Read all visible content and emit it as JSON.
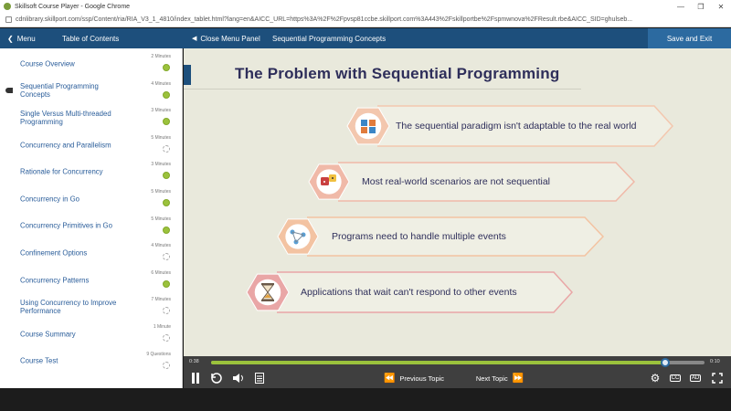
{
  "window": {
    "title": "Skillsoft Course Player - Google Chrome",
    "url": "cdnlibrary.skillport.com/ssp/Content/ria/RIA_V3_1_4810/index_tablet.html?lang=en&AICC_URL=https%3A%2F%2Fpvsp81ccbe.skillport.com%3A443%2Fskillportbe%2Fspmwnova%2FResult.rbe&AICC_SID=ghulseb..."
  },
  "topbar": {
    "menu_label": "Menu",
    "toc_title": "Table of Contents",
    "close_panel_label": "Close Menu Panel",
    "module_title": "Sequential Programming Concepts",
    "save_exit_label": "Save and Exit"
  },
  "toc": [
    {
      "label": "Course Overview",
      "duration": "2 Minutes",
      "status": "done",
      "current": false
    },
    {
      "label": "Sequential Programming Concepts",
      "duration": "4 Minutes",
      "status": "done",
      "current": true
    },
    {
      "label": "Single Versus Multi-threaded Programming",
      "duration": "3 Minutes",
      "status": "done",
      "current": false
    },
    {
      "label": "Concurrency and Parallelism",
      "duration": "5 Minutes",
      "status": "todo",
      "current": false
    },
    {
      "label": "Rationale for Concurrency",
      "duration": "3 Minutes",
      "status": "done",
      "current": false
    },
    {
      "label": "Concurrency in Go",
      "duration": "5 Minutes",
      "status": "done",
      "current": false
    },
    {
      "label": "Concurrency Primitives in Go",
      "duration": "5 Minutes",
      "status": "done",
      "current": false
    },
    {
      "label": "Confinement Options",
      "duration": "4 Minutes",
      "status": "todo",
      "current": false
    },
    {
      "label": "Concurrency Patterns",
      "duration": "6 Minutes",
      "status": "done",
      "current": false
    },
    {
      "label": "Using Concurrency to Improve Performance",
      "duration": "7 Minutes",
      "status": "todo",
      "current": false
    },
    {
      "label": "Course Summary",
      "duration": "1 Minute",
      "status": "todo",
      "current": false
    },
    {
      "label": "Course Test",
      "duration": "9 Questions",
      "status": "todo",
      "current": false
    }
  ],
  "slide": {
    "title": "The Problem with Sequential Programming",
    "points": [
      {
        "text": "The sequential paradigm isn't adaptable to the real world",
        "icon": "puzzle-icon",
        "color": "#f3c7ae"
      },
      {
        "text": "Most real-world scenarios are not sequential",
        "icon": "dice-icon",
        "color": "#f0b9a8"
      },
      {
        "text": "Programs need to handle multiple events",
        "icon": "network-icon",
        "color": "#f3c3a2"
      },
      {
        "text": "Applications that wait can't respond to other events",
        "icon": "hourglass-icon",
        "color": "#e9a6a6"
      }
    ]
  },
  "player": {
    "elapsed": "0:38",
    "remaining": "0:10",
    "progress": 0.92,
    "previous_label": "Previous Topic",
    "next_label": "Next Topic",
    "cc_label": "CC",
    "ad_label": "AD"
  },
  "colors": {
    "brand_blue": "#1d4f7c",
    "complete_green": "#9bc23c"
  }
}
